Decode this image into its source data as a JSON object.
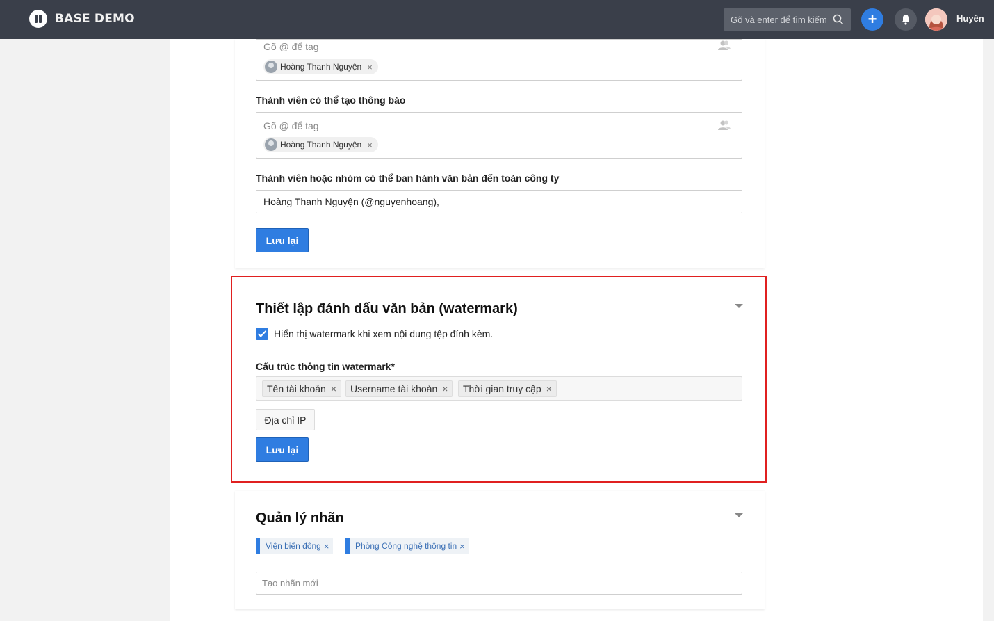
{
  "app": {
    "brand": "BASE DEMO",
    "search_placeholder": "Gõ và enter để tìm kiếm",
    "plus_label": "+",
    "user_name": "Huyền"
  },
  "permissions": {
    "tag_placeholder": "Gõ @ để tag",
    "top_box_member": "Hoàng Thanh Nguyện",
    "notify_label": "Thành viên có thể tạo thông báo",
    "notify_member": "Hoàng Thanh Nguyện",
    "publish_label": "Thành viên hoặc nhóm có thể ban hành văn bản đến toàn công ty",
    "publish_value": "Hoàng Thanh Nguyện (@nguyenhoang),",
    "save_label": "Lưu lại"
  },
  "watermark": {
    "title": "Thiết lập đánh dấu văn bản (watermark)",
    "checkbox_label": "Hiển thị watermark khi xem nội dung tệp đính kèm.",
    "checked": true,
    "structure_label": "Cấu trúc thông tin watermark*",
    "selected_fields": [
      "Tên tài khoản",
      "Username tài khoản",
      "Thời gian truy cập"
    ],
    "available_fields": [
      "Địa chỉ IP"
    ],
    "save_label": "Lưu lại",
    "highlight_color": "#e02020"
  },
  "labels": {
    "title": "Quản lý nhãn",
    "items": [
      "Viện biển đông",
      "Phòng Công nghệ thông tin"
    ],
    "new_placeholder": "Tạo nhãn mới",
    "accent_color": "#2f7de1"
  },
  "icons": {
    "remove": "×"
  }
}
